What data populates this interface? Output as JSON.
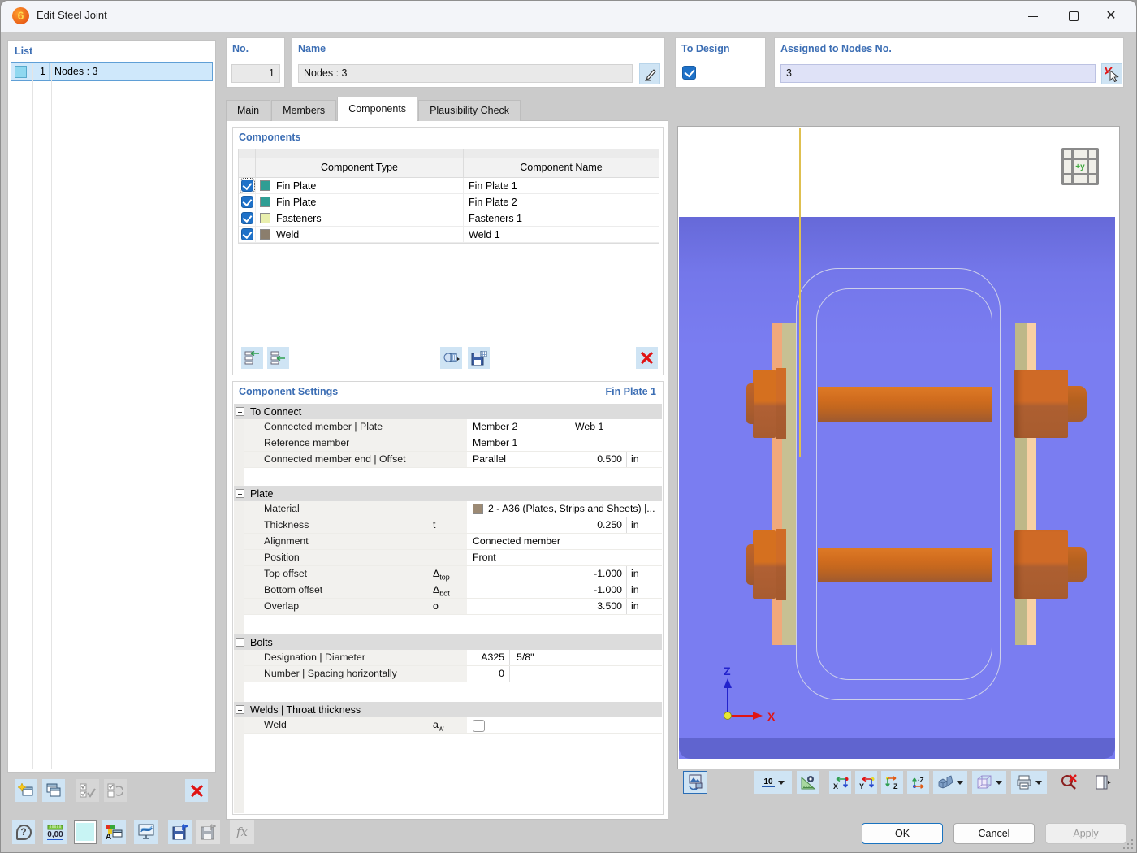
{
  "window": {
    "title": "Edit Steel Joint",
    "logo_text": "6"
  },
  "list_panel": {
    "header": "List",
    "rows": [
      {
        "num": "1",
        "name": "Nodes : 3",
        "swatch_color": "#8fd8f0"
      }
    ]
  },
  "header_fields": {
    "no": {
      "label": "No.",
      "value": "1"
    },
    "name": {
      "label": "Name",
      "value": "Nodes : 3"
    },
    "to_design": {
      "label": "To Design",
      "checked": true
    },
    "assigned": {
      "label": "Assigned to Nodes No.",
      "value": "3"
    }
  },
  "tabs": [
    {
      "label": "Main"
    },
    {
      "label": "Members"
    },
    {
      "label": "Components"
    },
    {
      "label": "Plausibility Check"
    }
  ],
  "active_tab": "Components",
  "components": {
    "title": "Components",
    "col_type": "Component Type",
    "col_name": "Component Name",
    "rows": [
      {
        "type": "Fin Plate",
        "name": "Fin Plate 1",
        "color": "#2f9e94",
        "checked": true
      },
      {
        "type": "Fin Plate",
        "name": "Fin Plate 2",
        "color": "#2f9e94",
        "checked": true
      },
      {
        "type": "Fasteners",
        "name": "Fasteners 1",
        "color": "#e9efad",
        "checked": true
      },
      {
        "type": "Weld",
        "name": "Weld 1",
        "color": "#8b7e6d",
        "checked": true
      }
    ]
  },
  "settings": {
    "title": "Component Settings",
    "subtitle": "Fin Plate 1",
    "to_connect": {
      "header": "To Connect",
      "rows": {
        "r1": {
          "label": "Connected member | Plate",
          "v1": "Member 2",
          "v2": "Web 1"
        },
        "r2": {
          "label": "Reference member",
          "v1": "Member 1"
        },
        "r3": {
          "label": "Connected member end | Offset",
          "v1": "Parallel",
          "num": "0.500",
          "unit": "in"
        }
      }
    },
    "plate": {
      "header": "Plate",
      "rows": {
        "material": {
          "label": "Material",
          "value": "2 - A36 (Plates, Strips and Sheets) |...",
          "swatch": "#9c8a74"
        },
        "thickness": {
          "label": "Thickness",
          "sym": "t",
          "num": "0.250",
          "unit": "in"
        },
        "alignment": {
          "label": "Alignment",
          "value": "Connected member"
        },
        "position": {
          "label": "Position",
          "value": "Front"
        },
        "top_offset": {
          "label": "Top offset",
          "sym": "Δ",
          "sub": "top",
          "num": "-1.000",
          "unit": "in"
        },
        "bottom_offset": {
          "label": "Bottom offset",
          "sym": "Δ",
          "sub": "bot",
          "num": "-1.000",
          "unit": "in"
        },
        "overlap": {
          "label": "Overlap",
          "sym": "o",
          "num": "3.500",
          "unit": "in"
        }
      }
    },
    "bolts": {
      "header": "Bolts",
      "rows": {
        "designation": {
          "label": "Designation | Diameter",
          "v1": "A325",
          "v2": "5/8\""
        },
        "number": {
          "label": "Number | Spacing horizontally",
          "v1": "0"
        }
      }
    },
    "welds": {
      "header": "Welds | Throat thickness",
      "rows": {
        "weld": {
          "label": "Weld",
          "sym": "a",
          "sub": "w",
          "checked": false
        }
      }
    }
  },
  "viewport": {
    "nav_cube_label": "+y",
    "axis_z": "Z",
    "axis_x": "X",
    "dim_button_label": "10",
    "colors": {
      "background": "#7a7df1",
      "bottom_band": "#6064cf",
      "tube_outline": "#cdd0ea",
      "guide_line": "#dfc050",
      "bolt_orange": "#d06c1e",
      "plate_peach": "#f1a87b",
      "plate_khaki": "#c7c093"
    }
  },
  "footer": {
    "ok": "OK",
    "cancel": "Cancel",
    "apply": "Apply",
    "help_icon_label": "?",
    "units_icon_label": "0,00",
    "fx_icon_label": "fx"
  }
}
